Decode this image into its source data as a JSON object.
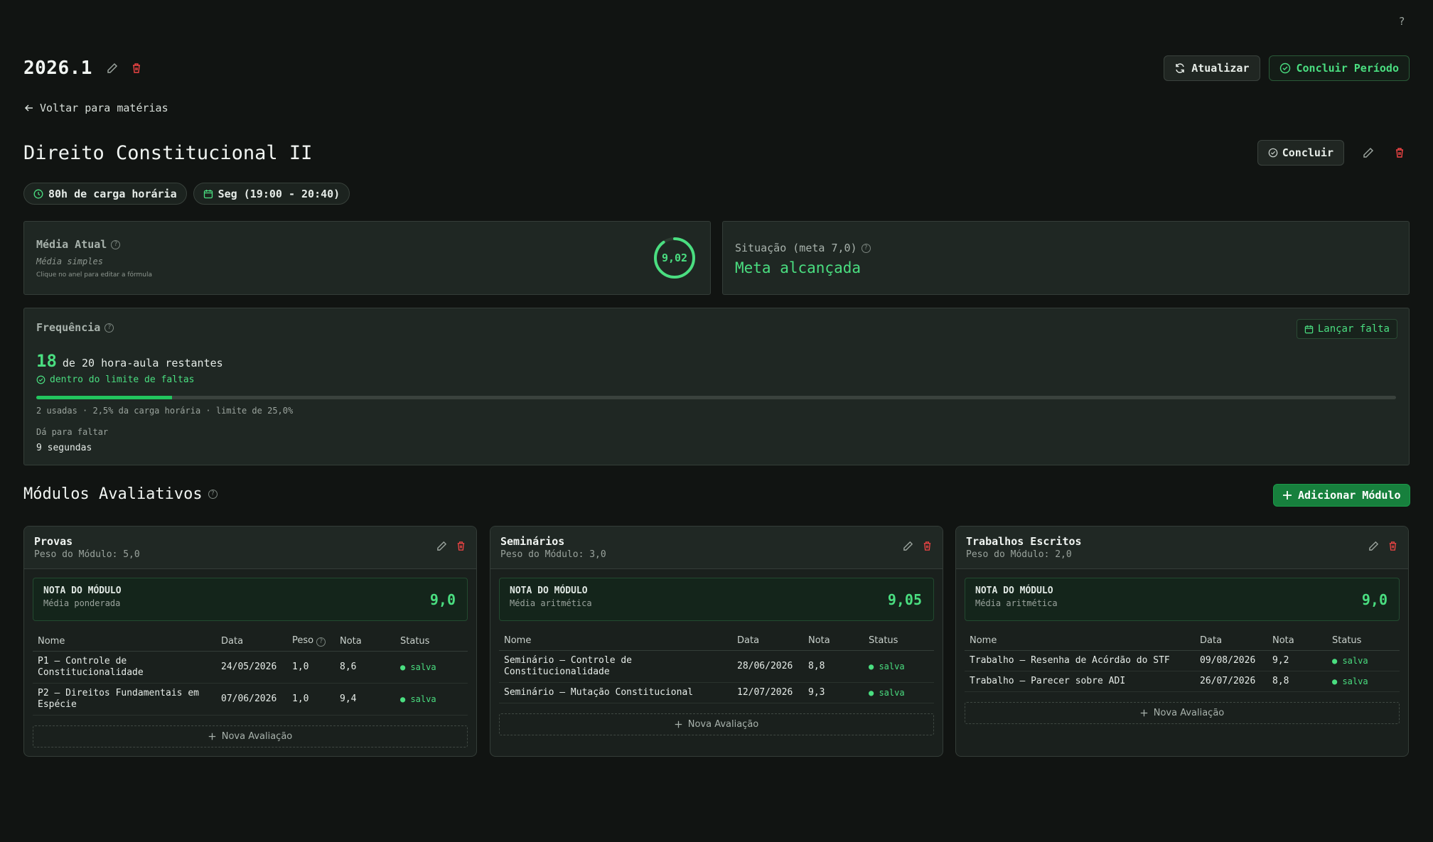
{
  "help": {
    "label": "?"
  },
  "period": {
    "title": "2026.1"
  },
  "top_actions": {
    "refresh_label": "Atualizar",
    "conclude_period_label": "Concluir Período"
  },
  "back": {
    "label": "Voltar para matérias"
  },
  "subject": {
    "title": "Direito Constitucional II",
    "conclude_label": "Concluir",
    "chips": {
      "workload": "80h de carga horária",
      "schedule": "Seg (19:00 - 20:40)"
    }
  },
  "average": {
    "label": "Média Atual",
    "method": "Média simples",
    "hint": "Clique no anel para editar a fórmula",
    "value": "9,02",
    "ring_fraction": 0.902
  },
  "situation": {
    "label": "Situação (meta 7,0)",
    "value": "Meta alcançada"
  },
  "frequency": {
    "label": "Frequência",
    "add_absence_label": "Lançar falta",
    "remaining": "18",
    "remaining_text": "de 20 hora-aula restantes",
    "status_text": "dentro do limite de faltas",
    "used_fraction": 0.1,
    "summary": "2 usadas · 2,5% da carga horária · limite de 25,0%",
    "can_miss_label": "Dá para faltar",
    "can_miss_value": "9 segundas"
  },
  "modules_section": {
    "title": "Módulos Avaliativos",
    "add_label": "Adicionar Módulo"
  },
  "modules": [
    {
      "name": "Provas",
      "weight": "Peso do Módulo: 5,0",
      "grade_label": "NOTA DO MÓDULO",
      "grade_method": "Média ponderada",
      "grade": "9,0",
      "columns": {
        "name": "Nome",
        "date": "Data",
        "weight": "Peso",
        "grade": "Nota",
        "status": "Status"
      },
      "rows": [
        {
          "name": "P1 — Controle de Constitucionalidade",
          "date": "24/05/2026",
          "weight": "1,0",
          "grade": "8,6",
          "status": "● salva"
        },
        {
          "name": "P2 — Direitos Fundamentais em Espécie",
          "date": "07/06/2026",
          "weight": "1,0",
          "grade": "9,4",
          "status": "● salva"
        }
      ],
      "new_label": "Nova Avaliação"
    },
    {
      "name": "Seminários",
      "weight": "Peso do Módulo: 3,0",
      "grade_label": "NOTA DO MÓDULO",
      "grade_method": "Média aritmética",
      "grade": "9,05",
      "columns": {
        "name": "Nome",
        "date": "Data",
        "grade": "Nota",
        "status": "Status"
      },
      "rows": [
        {
          "name": "Seminário — Controle de Constitucionalidade",
          "date": "28/06/2026",
          "grade": "8,8",
          "status": "● salva"
        },
        {
          "name": "Seminário — Mutação Constitucional",
          "date": "12/07/2026",
          "grade": "9,3",
          "status": "● salva"
        }
      ],
      "new_label": "Nova Avaliação"
    },
    {
      "name": "Trabalhos Escritos",
      "weight": "Peso do Módulo: 2,0",
      "grade_label": "NOTA DO MÓDULO",
      "grade_method": "Média aritmética",
      "grade": "9,0",
      "columns": {
        "name": "Nome",
        "date": "Data",
        "grade": "Nota",
        "status": "Status"
      },
      "rows": [
        {
          "name": "Trabalho — Resenha de Acórdão do STF",
          "date": "09/08/2026",
          "grade": "9,2",
          "status": "● salva"
        },
        {
          "name": "Trabalho — Parecer sobre ADI",
          "date": "26/07/2026",
          "grade": "8,8",
          "status": "● salva"
        }
      ],
      "new_label": "Nova Avaliação"
    }
  ]
}
